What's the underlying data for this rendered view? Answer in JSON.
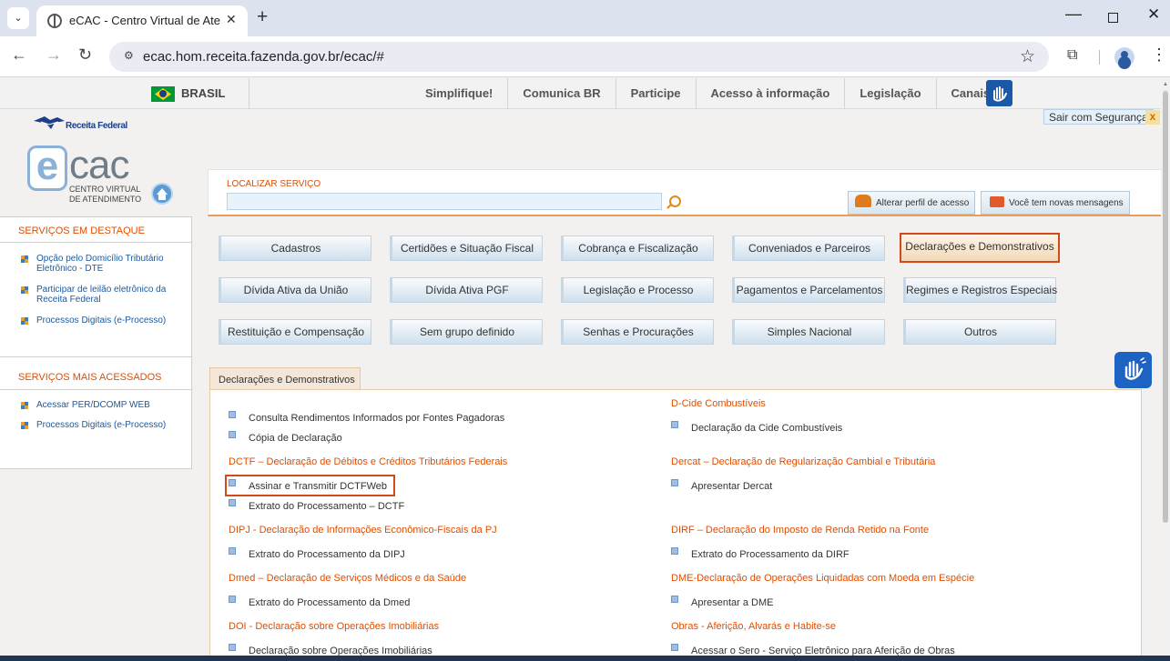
{
  "browser": {
    "tab_title": "eCAC - Centro Virtual de Atendimento",
    "tab_close": "✕",
    "new_tab": "+",
    "url": "ecac.hom.receita.fazenda.gov.br/ecac/#"
  },
  "govbar": {
    "country": "BRASIL",
    "links": [
      "Simplifique!",
      "Comunica BR",
      "Participe",
      "Acesso à informação",
      "Legislação",
      "Canais"
    ]
  },
  "header": {
    "logout": "Sair com Segurança",
    "logout_close": "x",
    "agency": "Receita Federal",
    "logo_e": "e",
    "logo_cac": "cac",
    "logo_sub1": "CENTRO VIRTUAL",
    "logo_sub2": "DE ATENDIMENTO",
    "search_label": "LOCALIZAR SERVIÇO",
    "search_value": "",
    "profile_button": "Alterar perfil de acesso",
    "messages_button": "Você tem novas mensagens"
  },
  "sidebar": {
    "featured_title": "SERVIÇOS EM DESTAQUE",
    "featured": [
      "Opção pelo Domicílio Tributário Eletrônico - DTE",
      "Participar de leilão eletrônico da Receita Federal",
      "Processos Digitais (e-Processo)"
    ],
    "most_title": "SERVIÇOS MAIS ACESSADOS",
    "most": [
      "Acessar PER/DCOMP WEB",
      "Processos Digitais (e-Processo)"
    ]
  },
  "categories": [
    "Cadastros",
    "Certidões e Situação Fiscal",
    "Cobrança e Fiscalização",
    "Conveniados e Parceiros",
    "Declarações e Demonstrativos",
    "Dívida Ativa da União",
    "Dívida Ativa PGF",
    "Legislação e Processo",
    "Pagamentos e Parcelamentos",
    "Regimes e Registros Especiais",
    "Restituição e Compensação",
    "Sem grupo definido",
    "Senhas e Procurações",
    "Simples Nacional",
    "Outros"
  ],
  "selected_category": "Declarações e Demonstrativos",
  "content": {
    "section_title": "Declarações e Demonstrativos",
    "left": {
      "item_consulta": "Consulta Rendimentos Informados por Fontes Pagadoras",
      "item_copia": "Cópia de Declaração",
      "dctf_title": "DCTF – Declaração de Débitos e Créditos Tributários Federais",
      "dctf_items": [
        "Assinar e Transmitir DCTFWeb",
        "Extrato do Processamento – DCTF"
      ],
      "dipj_title": "DIPJ - Declaração de Informações Econômico-Fiscais da PJ",
      "dipj_item": "Extrato do Processamento da DIPJ",
      "dmed_title": "Dmed – Declaração de Serviços Médicos e da Saúde",
      "dmed_item": "Extrato do Processamento da Dmed",
      "doi_title": "DOI - Declaração sobre Operações Imobiliárias",
      "doi_item": "Declaração sobre Operações Imobiliárias"
    },
    "right": {
      "dcide_title": "D-Cide Combustíveis",
      "dcide_item": "Declaração da Cide Combustíveis",
      "dercat_title": "Dercat – Declaração de Regularização Cambial e Tributária",
      "dercat_item": "Apresentar Dercat",
      "dirf_title": "DIRF – Declaração do Imposto de Renda Retido na Fonte",
      "dirf_item": "Extrato do Processamento da DIRF",
      "dme_title": "DME-Declaração de Operações Liquidadas com Moeda em Espécie",
      "dme_item": "Apresentar a DME",
      "obras_title": "Obras - Aferição, Alvarás e Habite-se",
      "obras_item": "Acessar o Sero - Serviço Eletrônico para Aferição de Obras"
    }
  },
  "colors": {
    "accent_orange": "#e04e00",
    "link_blue": "#1b5ba0",
    "highlight_red": "#d04a1c"
  }
}
